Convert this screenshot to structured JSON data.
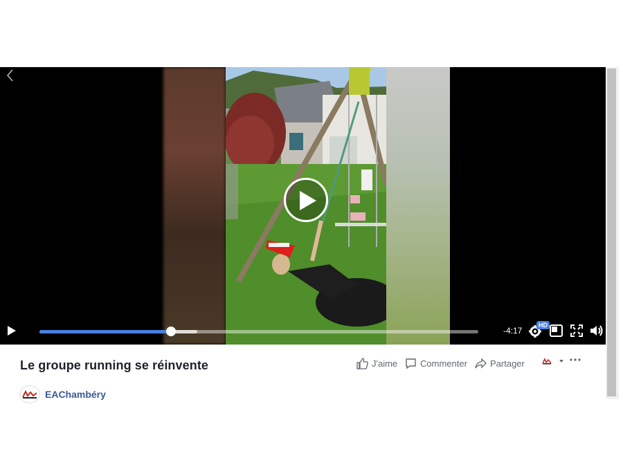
{
  "video": {
    "time_remaining": "-4:17",
    "progress": 0.3,
    "buffered": 0.36,
    "quality_badge": "HD"
  },
  "post": {
    "title": "Le groupe running se réinvente",
    "actions": {
      "like": "J'aime",
      "comment": "Commenter",
      "share": "Partager"
    },
    "page_name": "EAChambéry"
  },
  "colors": {
    "accent": "#4a7fe0",
    "link": "#385898",
    "action_text": "#606770"
  }
}
